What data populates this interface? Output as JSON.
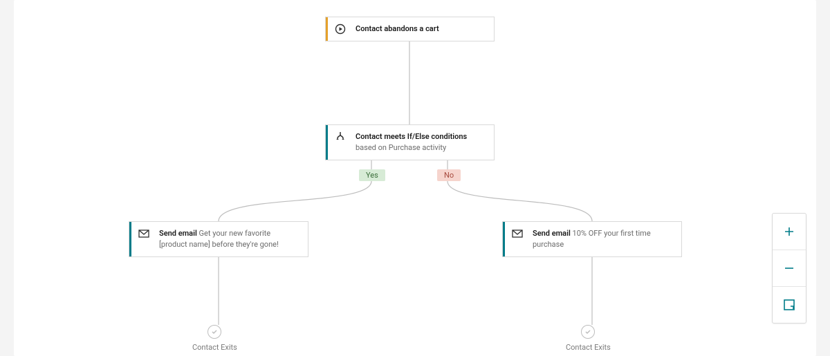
{
  "colors": {
    "accent_teal": "#007c89",
    "accent_orange": "#e5a12b",
    "yes_bg": "#d7ebd6",
    "no_bg": "#f6d4cd"
  },
  "trigger": {
    "icon": "play-circle-icon",
    "label": "Contact abandons a cart"
  },
  "condition": {
    "icon": "branch-icon",
    "label_bold": "Contact meets If/Else conditions",
    "label_light1": "based on",
    "label_light2": "Purchase activity"
  },
  "branch": {
    "yes": "Yes",
    "no": "No"
  },
  "email_yes": {
    "icon": "envelope-icon",
    "label_bold": "Send email",
    "label_light": "Get your new favorite [product name] before they're gone!"
  },
  "email_no": {
    "icon": "envelope-icon",
    "label_bold": "Send email",
    "label_light": "10% OFF your first time purchase"
  },
  "exit_left": {
    "icon": "check-circle-icon",
    "label": "Contact Exits"
  },
  "exit_right": {
    "icon": "check-circle-icon",
    "label": "Contact Exits"
  },
  "zoom": {
    "in_icon": "plus-icon",
    "out_icon": "minus-icon",
    "fit_icon": "fit-screen-icon"
  }
}
